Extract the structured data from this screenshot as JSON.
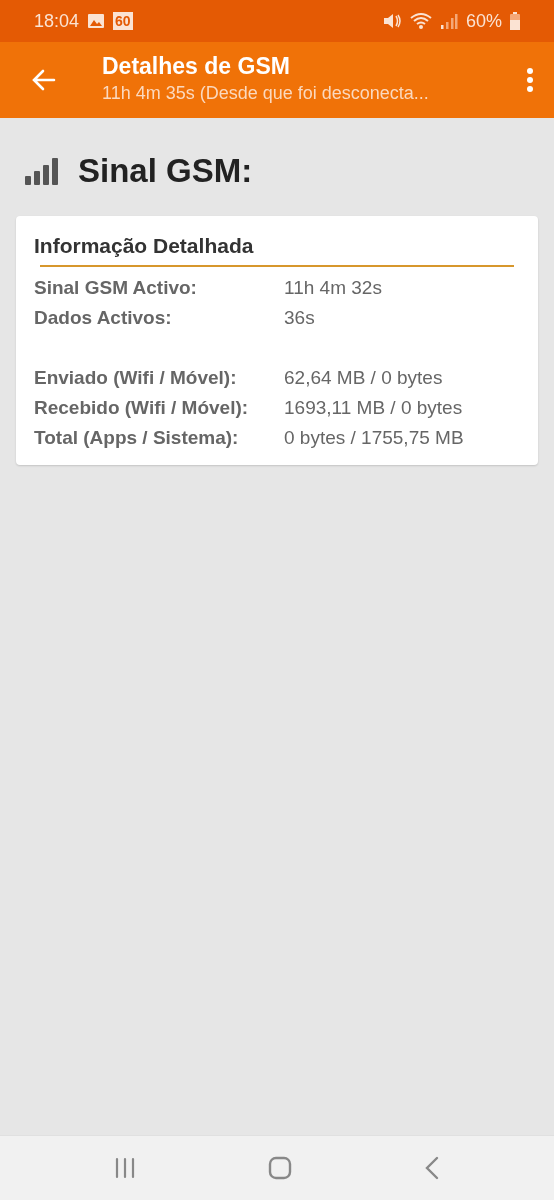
{
  "status_bar": {
    "time": "18:04",
    "badge": "60",
    "battery": "60%"
  },
  "app_bar": {
    "title": "Detalhes de GSM",
    "subtitle": "11h 4m 35s (Desde que foi desconecta..."
  },
  "header": {
    "title": "Sinal GSM:"
  },
  "card": {
    "title": "Informação Detalhada",
    "groups": [
      [
        {
          "label": "Sinal GSM Activo:",
          "value": "11h 4m 32s"
        },
        {
          "label": "Dados Activos:",
          "value": "36s"
        }
      ],
      [
        {
          "label": "Enviado (Wifi / Móvel):",
          "value": "62,64 MB / 0 bytes"
        },
        {
          "label": "Recebido (Wifi / Móvel):",
          "value": "1693,11 MB / 0 bytes"
        },
        {
          "label": "Total (Apps / Sistema):",
          "value": "0 bytes / 1755,75 MB"
        }
      ]
    ]
  }
}
